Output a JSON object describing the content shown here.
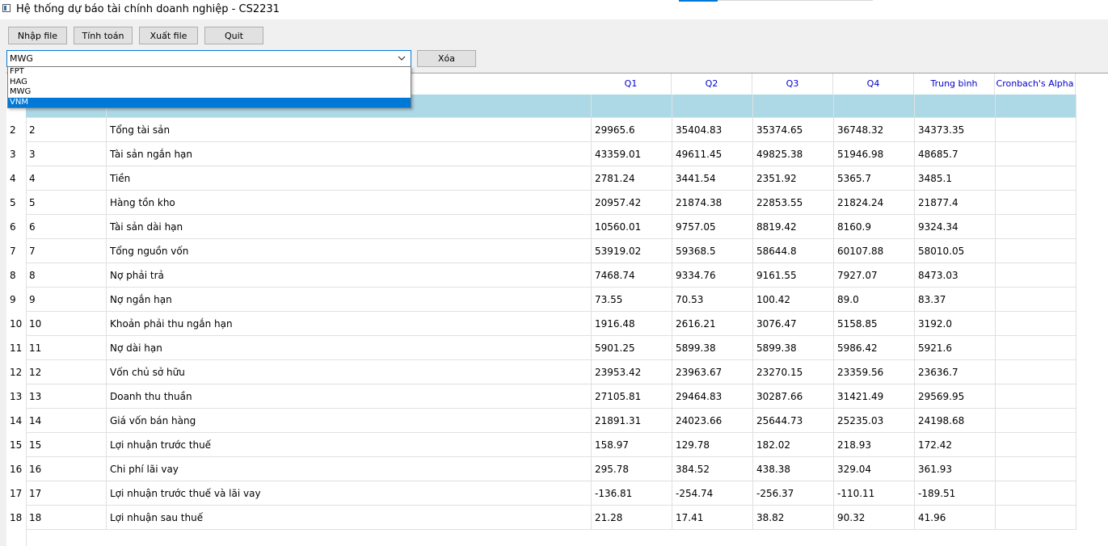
{
  "window": {
    "title": "Hệ thống dự báo tài chính doanh nghiệp - CS2231"
  },
  "toolbar": {
    "import_label": "Nhập file",
    "calc_label": "Tính toán",
    "export_label": "Xuất file",
    "quit_label": "Quit",
    "delete_label": "Xóa"
  },
  "company_select": {
    "selected": "MWG",
    "options": [
      "FPT",
      "HAG",
      "MWG",
      "VNM"
    ],
    "highlighted": "VNM"
  },
  "table": {
    "columns": [
      "Q1",
      "Q2",
      "Q3",
      "Q4",
      "Trung bình",
      "Cronbach's Alpha"
    ],
    "rows": [
      {
        "n": "2",
        "stt": "2",
        "name": "Tổng tài sản",
        "q1": "29965.6",
        "q2": "35404.83",
        "q3": "35374.65",
        "q4": "36748.32",
        "avg": "34373.35"
      },
      {
        "n": "3",
        "stt": "3",
        "name": "Tài sản ngắn hạn",
        "q1": "43359.01",
        "q2": "49611.45",
        "q3": "49825.38",
        "q4": "51946.98",
        "avg": "48685.7"
      },
      {
        "n": "4",
        "stt": "4",
        "name": "Tiền",
        "q1": "2781.24",
        "q2": "3441.54",
        "q3": "2351.92",
        "q4": "5365.7",
        "avg": "3485.1"
      },
      {
        "n": "5",
        "stt": "5",
        "name": "Hàng tồn kho",
        "q1": "20957.42",
        "q2": "21874.38",
        "q3": "22853.55",
        "q4": "21824.24",
        "avg": "21877.4"
      },
      {
        "n": "6",
        "stt": "6",
        "name": "Tài sản dài hạn",
        "q1": "10560.01",
        "q2": "9757.05",
        "q3": "8819.42",
        "q4": "8160.9",
        "avg": "9324.34"
      },
      {
        "n": "7",
        "stt": "7",
        "name": "Tổng nguồn vốn",
        "q1": "53919.02",
        "q2": "59368.5",
        "q3": "58644.8",
        "q4": "60107.88",
        "avg": "58010.05"
      },
      {
        "n": "8",
        "stt": "8",
        "name": "Nợ phải trả",
        "q1": "7468.74",
        "q2": "9334.76",
        "q3": "9161.55",
        "q4": "7927.07",
        "avg": "8473.03"
      },
      {
        "n": "9",
        "stt": "9",
        "name": "Nợ ngắn hạn",
        "q1": "73.55",
        "q2": "70.53",
        "q3": "100.42",
        "q4": "89.0",
        "avg": "83.37"
      },
      {
        "n": "10",
        "stt": "10",
        "name": "Khoản phải thu ngắn hạn",
        "q1": "1916.48",
        "q2": "2616.21",
        "q3": "3076.47",
        "q4": "5158.85",
        "avg": "3192.0"
      },
      {
        "n": "11",
        "stt": "11",
        "name": "Nợ dài hạn",
        "q1": "5901.25",
        "q2": "5899.38",
        "q3": "5899.38",
        "q4": "5986.42",
        "avg": "5921.6"
      },
      {
        "n": "12",
        "stt": "12",
        "name": "Vốn chủ sở hữu",
        "q1": "23953.42",
        "q2": "23963.67",
        "q3": "23270.15",
        "q4": "23359.56",
        "avg": "23636.7"
      },
      {
        "n": "13",
        "stt": "13",
        "name": "Doanh thu thuần",
        "q1": "27105.81",
        "q2": "29464.83",
        "q3": "30287.66",
        "q4": "31421.49",
        "avg": "29569.95"
      },
      {
        "n": "14",
        "stt": "14",
        "name": "Giá vốn bán hàng",
        "q1": "21891.31",
        "q2": "24023.66",
        "q3": "25644.73",
        "q4": "25235.03",
        "avg": "24198.68"
      },
      {
        "n": "15",
        "stt": "15",
        "name": "Lợi nhuận trước thuế",
        "q1": "158.97",
        "q2": "129.78",
        "q3": "182.02",
        "q4": "218.93",
        "avg": "172.42"
      },
      {
        "n": "16",
        "stt": "16",
        "name": "Chi phí lãi vay",
        "q1": "295.78",
        "q2": "384.52",
        "q3": "438.38",
        "q4": "329.04",
        "avg": "361.93"
      },
      {
        "n": "17",
        "stt": "17",
        "name": "Lợi nhuận trước thuế và lãi vay",
        "q1": "-136.81",
        "q2": "-254.74",
        "q3": "-256.37",
        "q4": "-110.11",
        "avg": "-189.51"
      },
      {
        "n": "18",
        "stt": "18",
        "name": "Lợi nhuận sau thuế",
        "q1": "21.28",
        "q2": "17.41",
        "q3": "38.82",
        "q4": "90.32",
        "avg": "41.96"
      }
    ]
  },
  "colors": {
    "header_text": "#0000cc",
    "highlight_row": "#add8e6",
    "selection": "#0078d7"
  }
}
